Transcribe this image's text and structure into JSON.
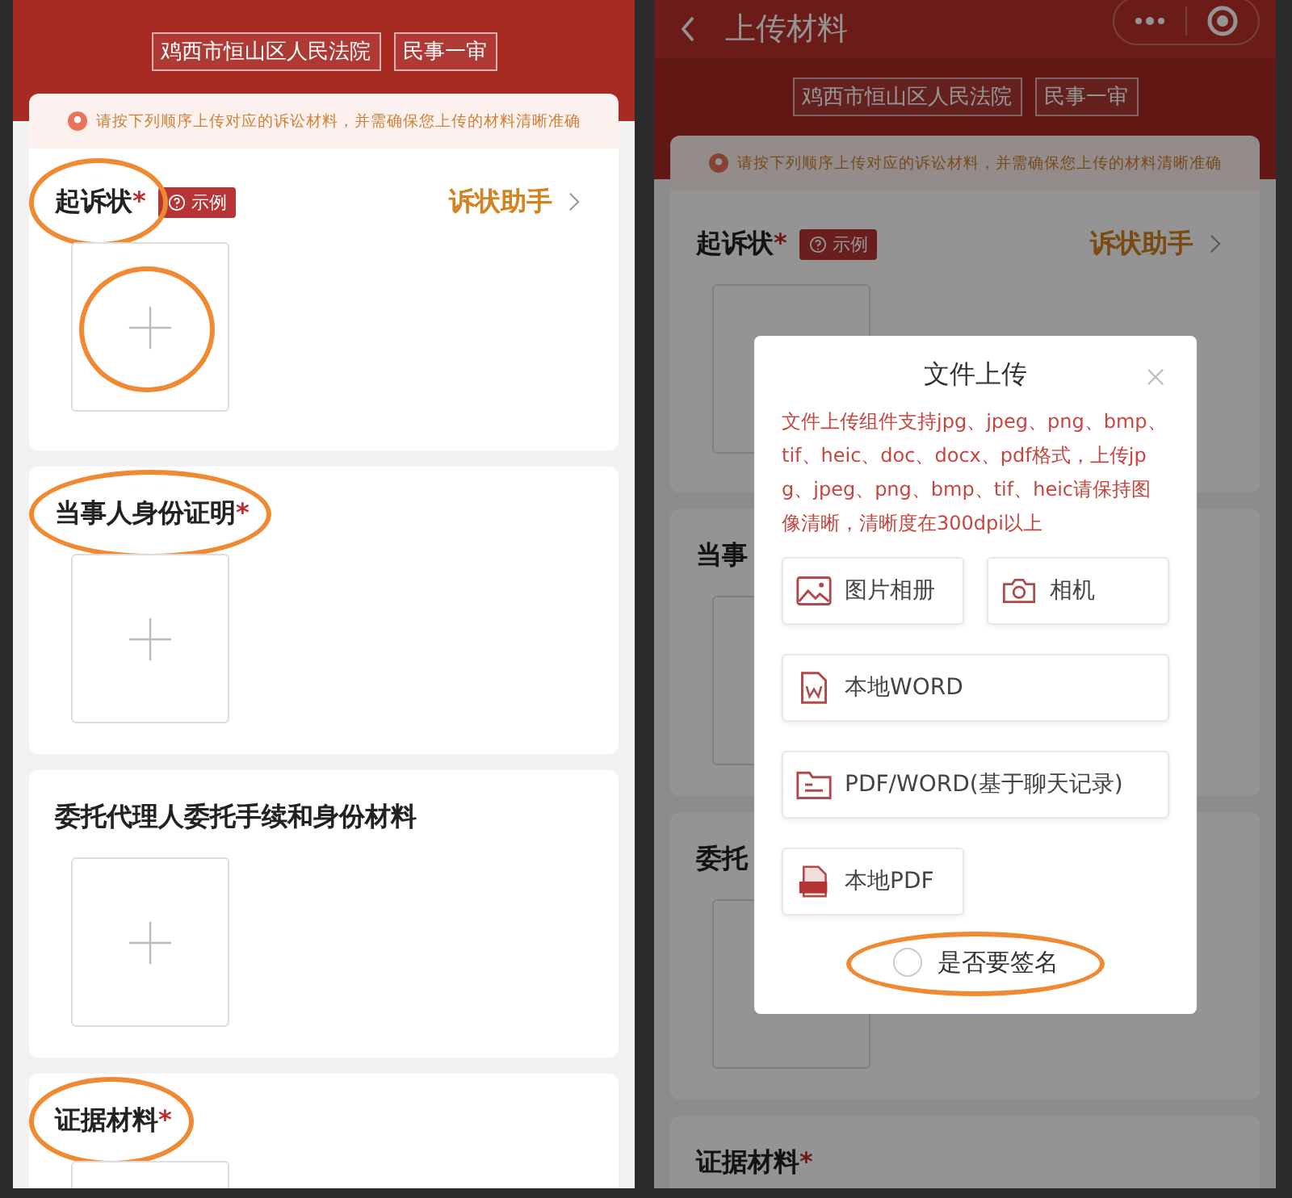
{
  "left_screen": {
    "court": "鸡西市恒山区人民法院",
    "case_type": "民事一审",
    "notice": "请按下列顺序上传对应的诉讼材料，并需确保您上传的材料清晰准确",
    "sections": [
      {
        "title": "起诉状",
        "mark": "*",
        "example": "示例",
        "assistant": "诉状助手",
        "highlighted": true,
        "upload_highlighted": true
      },
      {
        "title": "当事人身份证明",
        "mark": "*",
        "highlighted": true,
        "upload_highlighted": false
      },
      {
        "title": "委托代理人委托手续和身份材料",
        "highlighted": false,
        "upload_highlighted": false
      },
      {
        "title": "证据材料",
        "mark": "*",
        "highlighted": true,
        "upload_highlighted": false
      }
    ]
  },
  "right_screen": {
    "nav": {
      "title": "上传材料"
    },
    "court": "鸡西市恒山区人民法院",
    "case_type": "民事一审",
    "notice": "请按下列顺序上传对应的诉讼材料，并需确保您上传的材料清晰准确",
    "sections": [
      {
        "title": "起诉状",
        "mark": "*",
        "example": "示例",
        "assistant": "诉状助手",
        "highlighted": false,
        "upload_highlighted": false
      },
      {
        "title": "当事",
        "highlighted": false,
        "upload_highlighted": false
      },
      {
        "title": "委托",
        "highlighted": false,
        "upload_highlighted": false
      },
      {
        "title": "证据材料",
        "mark": "*",
        "highlighted": false,
        "upload_highlighted": false
      }
    ],
    "dialog": {
      "title": "文件上传",
      "description": "文件上传组件支持jpg、jpeg、png、bmp、tif、heic、doc、docx、pdf格式，上传jpg、jpeg、png、bmp、tif、heic请保持图像清晰，清晰度在300dpi以上",
      "options": [
        {
          "kind": "photo",
          "label": "图片相册",
          "wide": false
        },
        {
          "kind": "camera",
          "label": "相机",
          "wide": false
        },
        {
          "kind": "word",
          "label": "本地WORD",
          "wide": true
        },
        {
          "kind": "chat",
          "label": "PDF/WORD(基于聊天记录)",
          "wide": true
        },
        {
          "kind": "pdf",
          "label": "本地PDF",
          "wide": false
        }
      ],
      "sign": {
        "label": "是否要签名",
        "checked": false,
        "highlighted": true
      }
    }
  }
}
